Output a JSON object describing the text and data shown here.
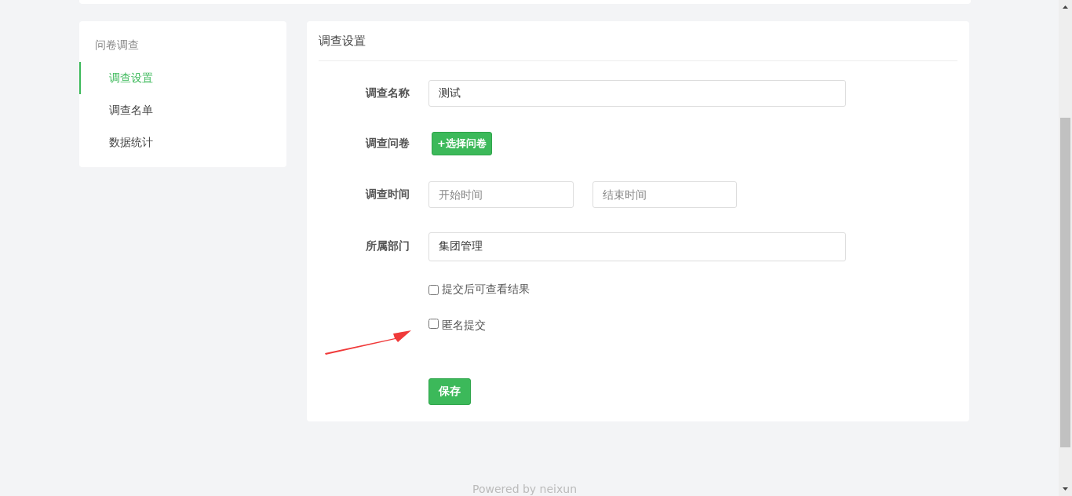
{
  "sidebar": {
    "title": "问卷调查",
    "items": [
      {
        "label": "调查设置",
        "selected": true
      },
      {
        "label": "调查名单",
        "selected": false
      },
      {
        "label": "数据统计",
        "selected": false
      }
    ]
  },
  "panel": {
    "title": "调查设置",
    "fields": [
      {
        "kind": "text",
        "label": "调查名称",
        "value": "测试"
      },
      {
        "kind": "button",
        "label": "调查问卷",
        "button": "+选择问卷"
      },
      {
        "kind": "range",
        "label": "调查时间",
        "start_placeholder": "开始时间",
        "end_placeholder": "结束时间"
      },
      {
        "kind": "text",
        "label": "所属部门",
        "value": "集团管理"
      }
    ],
    "checkboxes": [
      {
        "label": "提交后可查看结果",
        "checked": false
      },
      {
        "label": "匿名提交",
        "checked": false
      }
    ],
    "save_button": "保存"
  },
  "footer": "Powered by neixun"
}
